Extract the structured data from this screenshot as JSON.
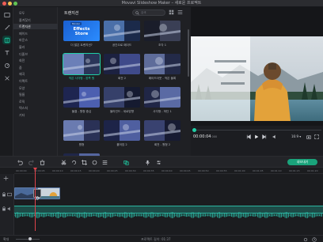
{
  "window": {
    "title": "Movavi Slideshow Maker – 새로운 프로젝트"
  },
  "sidebar_categories": [
    "모두",
    "즐겨찾기",
    "트랜지션",
    "페이드",
    "바운스",
    "블러",
    "디졸브",
    "회전",
    "줌",
    "왜곡",
    "이펙트",
    "모양",
    "필름",
    "로직",
    "텍스처",
    "기타"
  ],
  "sidebar_selected": 2,
  "gallery": {
    "title": "트랜지션",
    "search_placeholder": "검색",
    "items": [
      {
        "label": "더 많은 트랜지션?",
        "promo": "Effects Store",
        "promo_tag": "Movavi"
      },
      {
        "label": "공간으로 페이드"
      },
      {
        "label": "조각 1"
      },
      {
        "label": "작은 사각형 - 왼쪽 원",
        "selected": true
      },
      {
        "label": "회전 2"
      },
      {
        "label": "페이드아웃 - 작은 블록"
      },
      {
        "label": "물결 - 원형 중심"
      },
      {
        "label": "블라인드 - 세로방향"
      },
      {
        "label": "사각형 - 하단 1"
      },
      {
        "label": "원형"
      },
      {
        "label": "흩어짐 2"
      },
      {
        "label": "회전 - 원형 2"
      },
      {
        "label": "블록"
      }
    ]
  },
  "preview": {
    "time": "00:00:04",
    "time_ms": "000",
    "ratio": "16:9"
  },
  "toolbar": {
    "export_label": "내보내기"
  },
  "ruler": [
    "00:00:00",
    "00:00:05",
    "00:00:10",
    "00:00:15",
    "00:00:20",
    "00:00:25",
    "00:00:30",
    "00:00:35",
    "00:00:40",
    "00:00:45",
    "00:00:50",
    "00:00:55",
    "00:01:00",
    "00:01:05",
    "00:01:10",
    "00:01:15",
    "00:01:20"
  ],
  "status": {
    "zoom_label": "확대",
    "duration_label": "프로젝트 길이: 01:37"
  },
  "colors": {
    "accent": "#1fcfa6",
    "export": "#1aa37b",
    "playhead": "#e0434b",
    "audio_wave": "#2bb4a0"
  }
}
